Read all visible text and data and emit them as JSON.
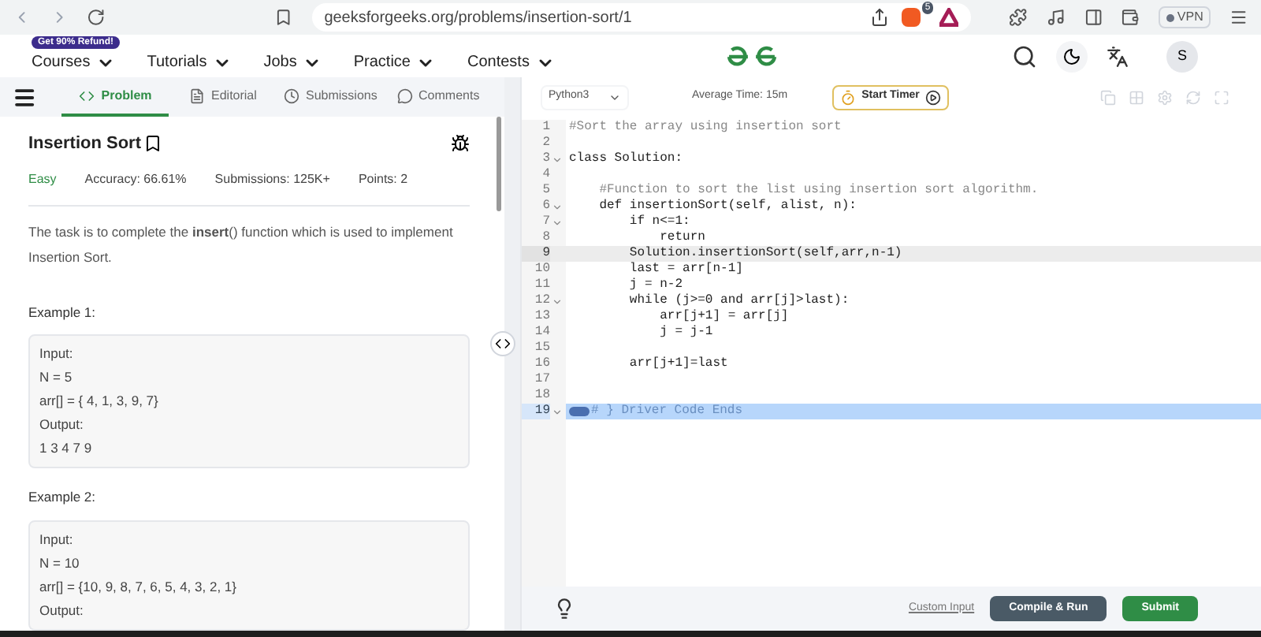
{
  "browser": {
    "url": "geeksforgeeks.org/problems/insertion-sort/1",
    "shield_count": "5",
    "vpn": "VPN"
  },
  "site_header": {
    "badge": "Get 90% Refund!",
    "nav": [
      "Courses",
      "Tutorials",
      "Jobs",
      "Practice",
      "Contests"
    ],
    "avatar": "S"
  },
  "problem_tabs": [
    {
      "label": "Problem",
      "selected": true
    },
    {
      "label": "Editorial",
      "selected": false
    },
    {
      "label": "Submissions",
      "selected": false
    },
    {
      "label": "Comments",
      "selected": false
    }
  ],
  "problem": {
    "title": "Insertion Sort",
    "difficulty": "Easy",
    "accuracy": "Accuracy: 66.61%",
    "submissions": "Submissions: 125K+",
    "points": "Points: 2",
    "description": "The task is to complete the **insert**() function which is used to implement Insertion Sort.",
    "examples": [
      {
        "heading": "Example 1:",
        "lines": [
          "Input:",
          "N = 5",
          "arr[] = { 4, 1, 3, 9, 7}",
          "Output:",
          "1 3 4 7 9"
        ]
      },
      {
        "heading": "Example 2:",
        "lines": [
          "Input:",
          "N = 10",
          "arr[] = {10, 9, 8, 7, 6, 5, 4, 3, 2, 1}",
          "Output:"
        ]
      }
    ]
  },
  "editor_toolbar": {
    "language": "Python3",
    "average_time": "Average Time: 15m",
    "timer_button": "Start Timer"
  },
  "code_lines": [
    {
      "number": "1",
      "text": "#Sort the array using insertion sort",
      "kind": "comment",
      "foldable": false,
      "active": false,
      "selected": false
    },
    {
      "number": "2",
      "kind": "code",
      "foldable": false,
      "active": false,
      "selected": false
    },
    {
      "number": "3",
      "text": "class Solution:",
      "kind": "code",
      "foldable": true,
      "active": false,
      "selected": false
    },
    {
      "number": "4",
      "kind": "code",
      "foldable": false,
      "active": false,
      "selected": false
    },
    {
      "number": "5",
      "text": "    #Function to sort the list using insertion sort algorithm.",
      "kind": "comment",
      "foldable": false,
      "active": false,
      "selected": false
    },
    {
      "number": "6",
      "text": "    def insertionSort(self, alist, n):",
      "kind": "code",
      "foldable": true,
      "active": false,
      "selected": false
    },
    {
      "number": "7",
      "text": "        if n<=1:",
      "kind": "code",
      "foldable": true,
      "active": false,
      "selected": false
    },
    {
      "number": "8",
      "text": "            return",
      "kind": "code",
      "foldable": false,
      "active": false,
      "selected": false
    },
    {
      "number": "9",
      "text": "        Solution.insertionSort(self,arr,n-1)",
      "kind": "code",
      "foldable": false,
      "active": true,
      "selected": false
    },
    {
      "number": "10",
      "text": "        last = arr[n-1]",
      "kind": "code",
      "foldable": false,
      "active": false,
      "selected": false
    },
    {
      "number": "11",
      "text": "        j = n-2",
      "kind": "code",
      "foldable": false,
      "active": false,
      "selected": false
    },
    {
      "number": "12",
      "text": "        while (j>=0 and arr[j]>last):",
      "kind": "code",
      "foldable": true,
      "active": false,
      "selected": false
    },
    {
      "number": "13",
      "text": "            arr[j+1] = arr[j]",
      "kind": "code",
      "foldable": false,
      "active": false,
      "selected": false
    },
    {
      "number": "14",
      "text": "            j = j-1",
      "kind": "code",
      "foldable": false,
      "active": false,
      "selected": false
    },
    {
      "number": "15",
      "kind": "code",
      "foldable": false,
      "active": false,
      "selected": false
    },
    {
      "number": "16",
      "text": "        arr[j+1]=last",
      "kind": "code",
      "foldable": false,
      "active": false,
      "selected": false
    },
    {
      "number": "17",
      "kind": "code",
      "foldable": false,
      "active": false,
      "selected": false
    },
    {
      "number": "18",
      "kind": "code",
      "foldable": false,
      "active": false,
      "selected": false
    },
    {
      "number": "19",
      "text": "# } Driver Code Ends",
      "kind": "folded",
      "foldable": true,
      "active": false,
      "selected": true
    }
  ],
  "footer": {
    "custom_input": "Custom Input",
    "compile_button": "Compile & Run",
    "submit_button": "Submit"
  }
}
